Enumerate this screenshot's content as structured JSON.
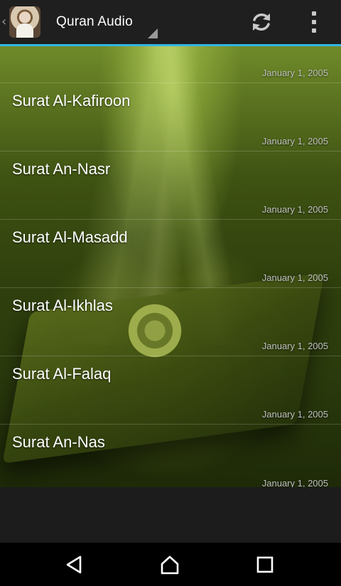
{
  "action_bar": {
    "title": "Quran Audio",
    "icons": {
      "up": "chevron-left-icon",
      "refresh": "refresh-icon",
      "overflow": "overflow-menu-icon"
    },
    "accent_color": "#33b5e5"
  },
  "list": {
    "items": [
      {
        "title": "",
        "date": "January 1, 2005"
      },
      {
        "title": "Surat Al-Kafiroon",
        "date": "January 1, 2005"
      },
      {
        "title": "Surat An-Nasr",
        "date": "January 1, 2005"
      },
      {
        "title": "Surat Al-Masadd",
        "date": "January 1, 2005"
      },
      {
        "title": "Surat Al-Ikhlas",
        "date": "January 1, 2005"
      },
      {
        "title": "Surat Al-Falaq",
        "date": "January 1, 2005"
      },
      {
        "title": "Surat An-Nas",
        "date": "January 1, 2005"
      }
    ]
  },
  "nav_bar": {
    "icons": {
      "back": "back-triangle-icon",
      "home": "home-icon",
      "recents": "recents-square-icon"
    }
  }
}
